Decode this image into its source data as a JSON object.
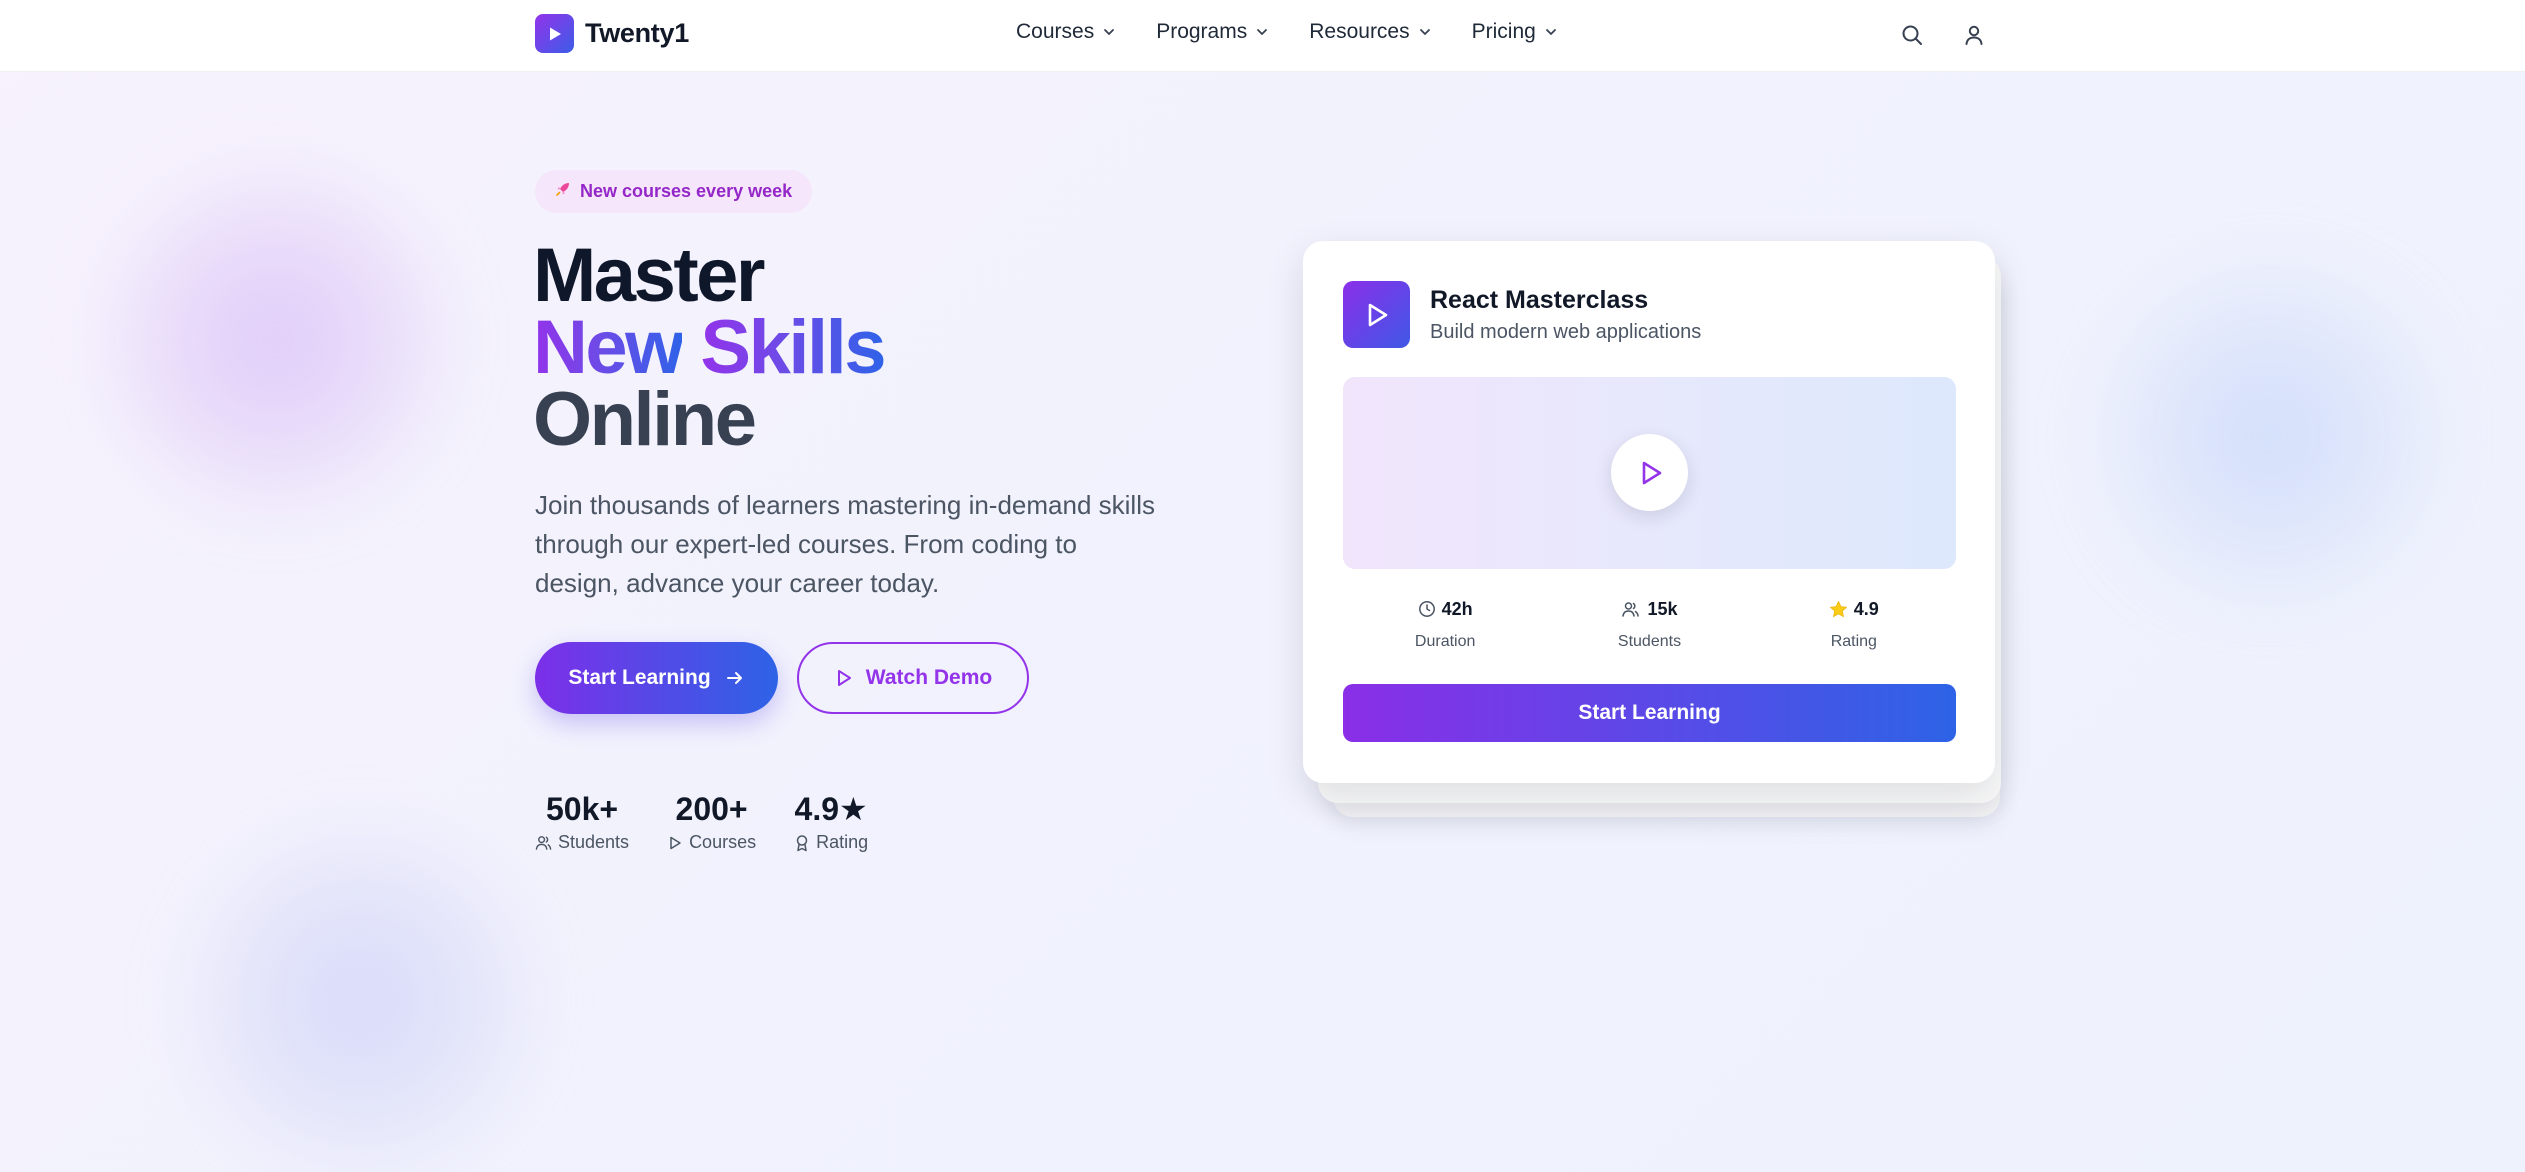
{
  "brand": {
    "name": "Twenty1",
    "icon": "play-icon"
  },
  "nav": {
    "items": [
      {
        "label": "Courses",
        "icon": "chevron-down-icon"
      },
      {
        "label": "Programs",
        "icon": "chevron-down-icon"
      },
      {
        "label": "Resources",
        "icon": "chevron-down-icon"
      },
      {
        "label": "Pricing",
        "icon": "chevron-down-icon"
      }
    ],
    "tools": [
      "search-icon",
      "user-icon"
    ]
  },
  "hero": {
    "badge": {
      "icon": "rocket-icon",
      "text": "New courses every week"
    },
    "headline": {
      "line1": "Master",
      "line2a": "New",
      "line2b": "Skills",
      "line3": "Online"
    },
    "description": "Join thousands of learners mastering in-demand skills through our expert-led courses. From coding to design, advance your career today.",
    "primary_cta": {
      "label": "Start Learning",
      "icon": "arrow-right-icon"
    },
    "secondary_cta": {
      "label": "Watch Demo",
      "icon": "play-icon"
    },
    "stats": [
      {
        "value": "50k+",
        "label": "Students",
        "icon": "users-icon"
      },
      {
        "value": "200+",
        "label": "Courses",
        "icon": "play-icon"
      },
      {
        "value": "4.9★",
        "label": "Rating",
        "icon": "award-icon"
      }
    ]
  },
  "course_card": {
    "title": "React Masterclass",
    "subtitle": "Build modern web applications",
    "metrics": [
      {
        "value": "42h",
        "label": "Duration",
        "icon": "clock-icon"
      },
      {
        "value": "15k",
        "label": "Students",
        "icon": "users-icon"
      },
      {
        "value": "4.9",
        "label": "Rating",
        "icon": "star-icon"
      }
    ],
    "cta": "Start Learning"
  },
  "colors": {
    "brand_purple": "#9333ea",
    "brand_blue": "#2d63e6",
    "star_yellow": "#facc15"
  }
}
